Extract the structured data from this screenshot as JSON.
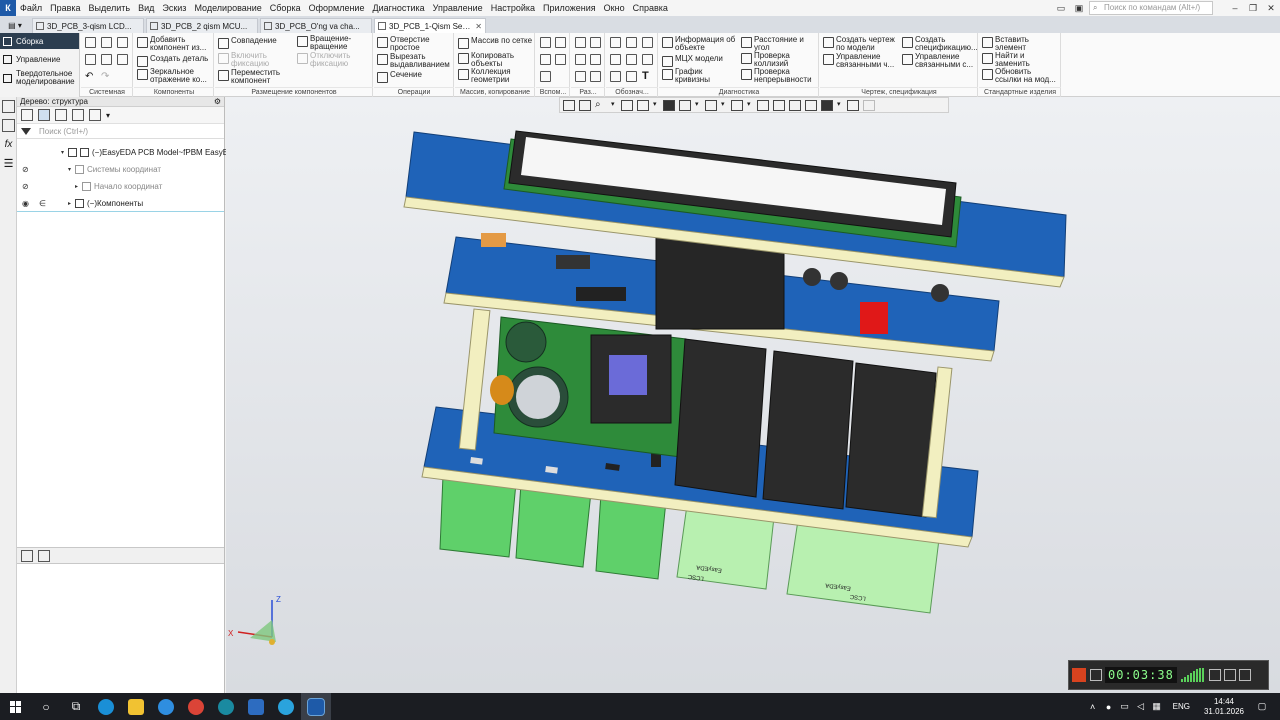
{
  "menubar": {
    "logo": "К",
    "items": [
      "Файл",
      "Правка",
      "Выделить",
      "Вид",
      "Эскиз",
      "Моделирование",
      "Сборка",
      "Оформление",
      "Диагностика",
      "Управление",
      "Настройка",
      "Приложения",
      "Окно",
      "Справка"
    ],
    "search_placeholder": "Поиск по командам (Alt+/)"
  },
  "tabs": [
    {
      "label": "3D_PCB_3-qism LCD...",
      "active": false
    },
    {
      "label": "3D_PCB_2 qism MCU...",
      "active": false
    },
    {
      "label": "3D_PCB_O'ng va cha...",
      "active": false
    },
    {
      "label": "3D_PCB_1-Qism Sens...",
      "active": true
    }
  ],
  "ribbon": {
    "side": [
      "Сборка",
      "Управление",
      "Твердотельное моделирование"
    ],
    "groups": {
      "sistemnaya": "Системная",
      "komponenty": "Компоненты",
      "razmeschenie": "Размещение компонентов",
      "operacii": "Операции",
      "massiv": "Массив, копирование",
      "vspom": "Вспом...",
      "raz": "Раз...",
      "oboznach": "Обознач...",
      "diagnostika": "Диагностика",
      "chertezh": "Чертеж, спецификация",
      "standart": "Стандартные изделия"
    },
    "buttons": {
      "add_component": "Добавить компонент из...",
      "create_part": "Создать деталь",
      "mirror": "Зеркальное отражение ко...",
      "coincide": "Совпадение",
      "rotation": "Вращение-вращение",
      "enable_fix": "Включить фиксацию",
      "disable_fix": "Отключить фиксацию",
      "move_component": "Переместить компонент",
      "simple_hole": "Отверстие простое",
      "extrude_cut": "Вырезать выдавливанием",
      "section": "Сечение",
      "grid_array": "Массив по сетке",
      "copy_objects": "Копировать объекты",
      "geometry_collection": "Коллекция геометрии",
      "object_info": "Информация об объекте",
      "mass_props": "МЦХ модели",
      "curvature_graph": "График кривизны",
      "distance_angle": "Расстояние и угол",
      "collision_check": "Проверка коллизий",
      "continuity_check": "Проверка непрерывности",
      "create_drawing": "Создать чертеж по модели",
      "manage_linked": "Управление связанными ч...",
      "create_spec": "Создать спецификацию...",
      "manage_linked_s": "Управление связанными с...",
      "insert_element": "Вставить элемент",
      "find_replace": "Найти и заменить",
      "update_links": "Обновить ссылки на мод..."
    }
  },
  "tree": {
    "title": "Дерево: структура",
    "search_placeholder": "Поиск (Ctrl+/)",
    "rows": [
      {
        "label": "(−)EasyEDA PCB Model~fPBM EasyEDA"
      },
      {
        "label": "Системы координат"
      },
      {
        "label": "Начало координат"
      },
      {
        "label": "(−)Компоненты"
      }
    ]
  },
  "pcb": {
    "silk": [
      "LCSC",
      "EasyEDA"
    ]
  },
  "triad": {
    "x": "X",
    "z": "Z"
  },
  "recorder": {
    "time": "00:03:38"
  },
  "taskbar": {
    "lang": "ENG",
    "time": "14:44",
    "date": "31.01.2026"
  },
  "colors": {
    "pcb_blue": "#1f63b8",
    "pcb_green": "#2e8b3a",
    "standoff": "#f2efc0",
    "terminal_green": "#5fd06a",
    "terminal_light": "#b8f0b0",
    "relay_black": "#2b2b2b",
    "accent_red": "#e01818"
  }
}
